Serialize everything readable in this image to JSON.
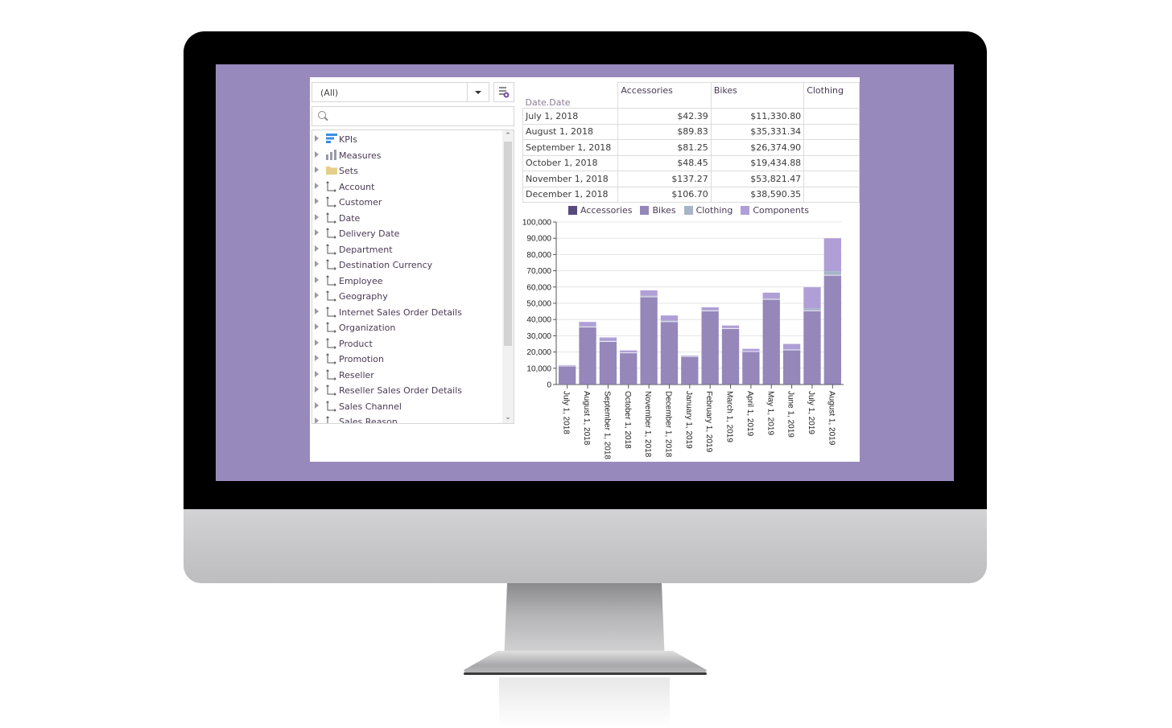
{
  "colors": {
    "screen_bg": "#9889bd",
    "accessories": "#584a7e",
    "bikes": "#9587ba",
    "clothing": "#a8b4c8",
    "components": "#b09fd6"
  },
  "filter": {
    "combo_value": "(All)",
    "combo_icon": "chevron-down-icon",
    "config_icon": "field-list-settings-icon",
    "search_placeholder": "",
    "search_icon": "search-icon"
  },
  "tree": {
    "items": [
      {
        "label": "KPIs",
        "icon": "kpi-icon"
      },
      {
        "label": "Measures",
        "icon": "measures-icon"
      },
      {
        "label": "Sets",
        "icon": "folder-icon"
      },
      {
        "label": "Account",
        "icon": "dimension-icon"
      },
      {
        "label": "Customer",
        "icon": "dimension-icon"
      },
      {
        "label": "Date",
        "icon": "dimension-icon"
      },
      {
        "label": "Delivery Date",
        "icon": "dimension-icon"
      },
      {
        "label": "Department",
        "icon": "dimension-icon"
      },
      {
        "label": "Destination Currency",
        "icon": "dimension-icon"
      },
      {
        "label": "Employee",
        "icon": "dimension-icon"
      },
      {
        "label": "Geography",
        "icon": "dimension-icon"
      },
      {
        "label": "Internet Sales Order Details",
        "icon": "dimension-icon"
      },
      {
        "label": "Organization",
        "icon": "dimension-icon"
      },
      {
        "label": "Product",
        "icon": "dimension-icon"
      },
      {
        "label": "Promotion",
        "icon": "dimension-icon"
      },
      {
        "label": "Reseller",
        "icon": "dimension-icon"
      },
      {
        "label": "Reseller Sales Order Details",
        "icon": "dimension-icon"
      },
      {
        "label": "Sales Channel",
        "icon": "dimension-icon"
      },
      {
        "label": "Sales Reason",
        "icon": "dimension-icon"
      }
    ]
  },
  "grid": {
    "row_header": "Date.Date",
    "columns": [
      "Accessories",
      "Bikes",
      "Clothing"
    ],
    "rows": [
      {
        "date": "July 1, 2018",
        "accessories": "$42.39",
        "bikes": "$11,330.80",
        "clothing": ""
      },
      {
        "date": "August 1, 2018",
        "accessories": "$89.83",
        "bikes": "$35,331.34",
        "clothing": ""
      },
      {
        "date": "September 1, 2018",
        "accessories": "$81.25",
        "bikes": "$26,374.90",
        "clothing": ""
      },
      {
        "date": "October 1, 2018",
        "accessories": "$48.45",
        "bikes": "$19,434.88",
        "clothing": ""
      },
      {
        "date": "November 1, 2018",
        "accessories": "$137.27",
        "bikes": "$53,821.47",
        "clothing": ""
      },
      {
        "date": "December 1, 2018",
        "accessories": "$106.70",
        "bikes": "$38,590.35",
        "clothing": ""
      }
    ]
  },
  "chart_data": {
    "type": "bar",
    "stacked": true,
    "title": "",
    "xlabel": "",
    "ylabel": "",
    "ylim": [
      0,
      100000
    ],
    "yticks": [
      "0",
      "10,000",
      "20,000",
      "30,000",
      "40,000",
      "50,000",
      "60,000",
      "70,000",
      "80,000",
      "90,000",
      "100,000"
    ],
    "ytick_values": [
      0,
      10000,
      20000,
      30000,
      40000,
      50000,
      60000,
      70000,
      80000,
      90000,
      100000
    ],
    "grid": true,
    "legend_position": "top",
    "categories": [
      "July 1, 2018",
      "August 1, 2018",
      "September 1, 2018",
      "October 1, 2018",
      "November 1, 2018",
      "December 1, 2018",
      "January 1, 2019",
      "February 1, 2019",
      "March 1, 2019",
      "April 1, 2019",
      "May 1, 2019",
      "June 1, 2019",
      "July 1, 2019",
      "August 1, 2019"
    ],
    "series": [
      {
        "name": "Accessories",
        "values": [
          42.39,
          89.83,
          81.25,
          48.45,
          137.27,
          106.7,
          60,
          120,
          100,
          70,
          130,
          80,
          150,
          200
        ]
      },
      {
        "name": "Bikes",
        "values": [
          11330.8,
          35331.34,
          26374.9,
          19434.88,
          53821.47,
          38590.35,
          17200,
          45200,
          34300,
          20200,
          52300,
          21200,
          45200,
          67000
        ]
      },
      {
        "name": "Clothing",
        "values": [
          200,
          500,
          500,
          300,
          600,
          600,
          200,
          400,
          400,
          300,
          500,
          300,
          1500,
          2500
        ]
      },
      {
        "name": "Components",
        "values": [
          400,
          2600,
          2000,
          1200,
          3400,
          3200,
          400,
          1800,
          1500,
          1400,
          3600,
          3400,
          13000,
          20300
        ]
      }
    ]
  }
}
